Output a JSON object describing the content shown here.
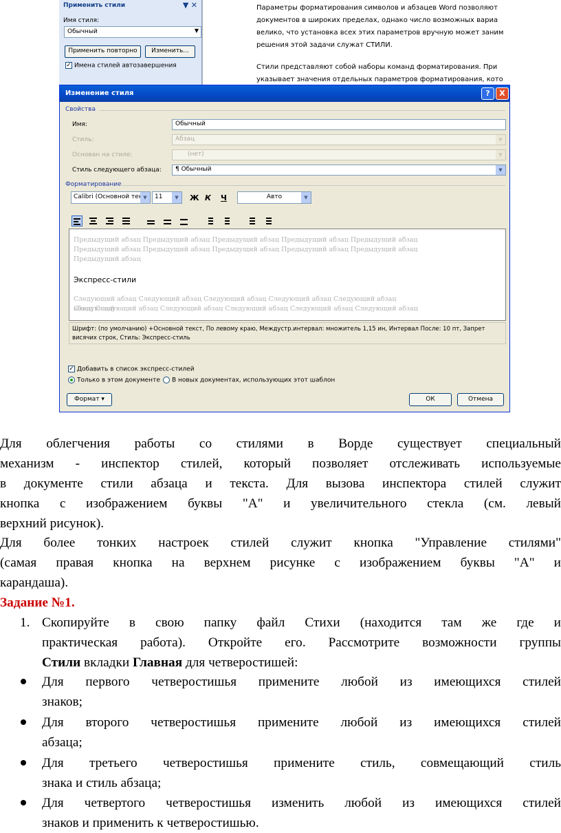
{
  "screenshot": {
    "styles_pane": {
      "title": "Применить стили",
      "controls": "▼ ✕",
      "style_name_label": "Имя стиля:",
      "style_name_value": "Обычный",
      "reapply_button": "Применить повторно",
      "modify_button": "Изменить...",
      "autocomplete_checkbox": "Имена стилей автозавершения"
    },
    "doc_background_lines": [
      "Параметры форматирования символов и абзацев Word позволяют",
      "документов в широких пределах, однако число возможных вариа",
      "велико, что установка всех этих параметров вручную может заним",
      "решения этой задачи служат СТИЛИ.",
      "Стили представляют собой наборы команд форматирования. При",
      "указывает значения отдельных параметров форматирования, кото"
    ],
    "dialog": {
      "title": "Изменение стиля",
      "help": "?",
      "close": "X",
      "properties_section": "Свойства",
      "name_label": "Имя:",
      "name_value": "Обычный",
      "style_type_label": "Стиль:",
      "style_type_value": "Абзац",
      "based_on_label": "Основан на стиле:",
      "based_on_value": "(нет)",
      "next_style_label": "Стиль следующего абзаца:",
      "next_style_value": "¶ Обычный",
      "formatting_section": "Форматирование",
      "font_value": "Calibri (Основной тек",
      "size_value": "11",
      "bold": "Ж",
      "italic": "К",
      "underline": "Ч",
      "color_value": "Авто",
      "preview_prev_lines": [
        "Предыдущий абзац Предыдущий абзац Предыдущий абзац Предыдущий абзац Предыдущий абзац",
        "Предыдущий абзац Предыдущий абзац Предыдущий абзац Предыдущий абзац Предыдущий абзац",
        "Предыдущий абзац"
      ],
      "preview_sample": "Экспресс-стили",
      "preview_next_lines": [
        "Следующий абзац Следующий абзац Следующий абзац Следующий абзац Следующий абзац Следующий",
        "абзац Следующий абзац Следующий абзац Следующий абзац Следующий абзац Следующий абзац"
      ],
      "description_lines": [
        "Шрифт: (по умолчанию) +Основной текст, По левому краю, Междустр.интервал:  множитель 1,15 ин, Интервал После:  10 пт, Запрет",
        "висячих строк, Стиль: Экспресс-стиль"
      ],
      "add_quick_styles": "Добавить в список экспресс-стилей",
      "only_this_doc": "Только в этом документе",
      "new_docs": "В новых документах, использующих этот шаблон",
      "format_button": "Формат ▾",
      "ok_button": "ОК",
      "cancel_button": "Отмена"
    }
  },
  "body": {
    "para1_lines": [
      "Для облегчения работы со стилями в Ворде существует специальный",
      "механизм - инспектор стилей, который позволяет отслеживать используемые",
      "в документе стили абзаца и текста. Для вызова инспектора стилей служит",
      "кнопка с изображением буквы \"А\" и увеличительного стекла (см. левый",
      "верхний рисунок)."
    ],
    "para2_lines": [
      "Для более тонких настроек стилей служит кнопка \"Управление стилями\"",
      "(самая правая кнопка на верхнем рисунке с изображением буквы \"А\" и",
      "карандаша)."
    ],
    "task_heading": "Задание №1.",
    "item1": {
      "marker": "1.",
      "line1": "Скопируйте в свою папку файл Стихи (находится там же где и",
      "line2": "практическая работа). Откройте его. Рассмотрите возможности группы",
      "line3_b1": "Стили",
      "line3_t1": " вкладки ",
      "line3_b2": "Главная",
      "line3_t2": " для четверостишей:"
    },
    "bullets": [
      {
        "line1": "Для первого четверостишья примените любой из имеющихся стилей",
        "line2": "знаков;"
      },
      {
        "line1": "Для второго четверостишья примените любой из имеющихся стилей",
        "line2": "абзаца;"
      },
      {
        "line1": "Для третьего четверостишья примените стиль, совмещающий стиль",
        "line2": "знака и стиль абзаца;"
      },
      {
        "line1": "Для четвертого четверостишья изменить любой из имеющихся стилей",
        "line2": "знаков и применить к четверостишью."
      }
    ]
  }
}
